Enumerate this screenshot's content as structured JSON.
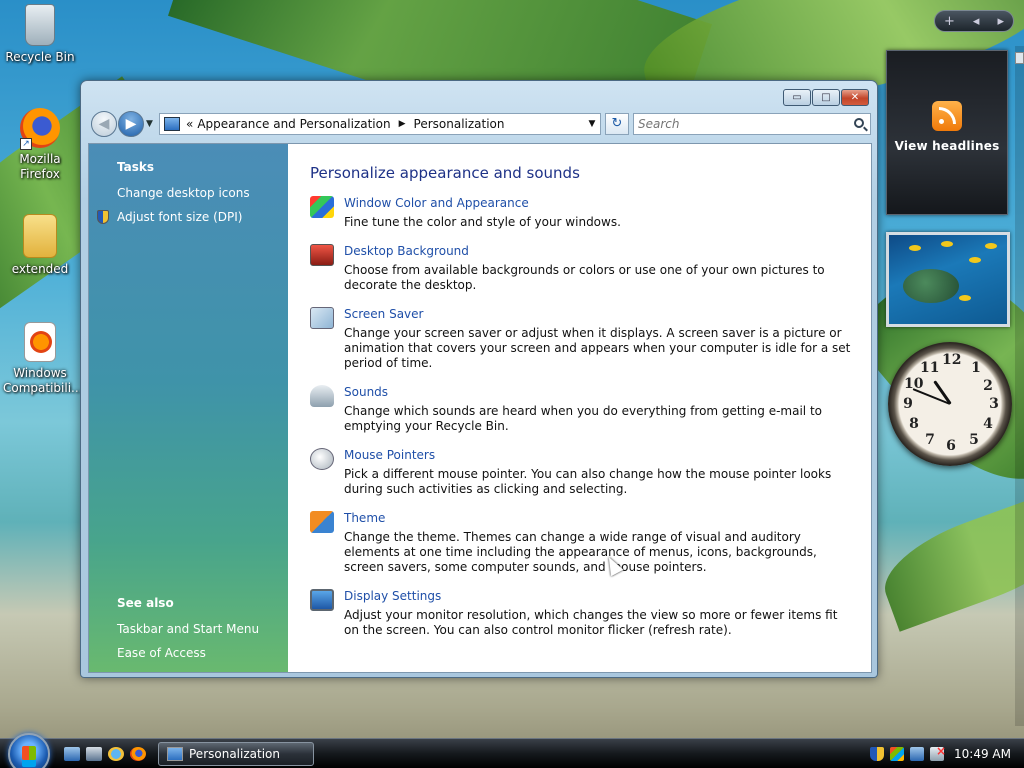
{
  "desktop": {
    "icons": [
      {
        "label": "Recycle Bin"
      },
      {
        "label": "Mozilla Firefox"
      },
      {
        "label": "extended"
      },
      {
        "label": "Windows Compatibili..."
      }
    ]
  },
  "sidebar": {
    "add_symbol": "+",
    "prev_symbol": "◂",
    "next_symbol": "▸",
    "feed_gadget_label": "View headlines"
  },
  "window": {
    "controls": {
      "minimize": "▭",
      "maximize": "□",
      "close": "✕"
    },
    "nav": {
      "back_symbol": "◀",
      "forward_symbol": "▶",
      "recent_symbol": "▼"
    },
    "address": {
      "overflow": "«",
      "crumbs": [
        "Appearance and Personalization",
        "Personalization"
      ],
      "separator": "▶",
      "dropdown": "▼"
    },
    "refresh_symbol": "↻",
    "search": {
      "placeholder": "Search"
    },
    "left_pane": {
      "tasks_heading": "Tasks",
      "tasks": [
        "Change desktop icons",
        "Adjust font size (DPI)"
      ],
      "see_also_heading": "See also",
      "see_also": [
        "Taskbar and Start Menu",
        "Ease of Access"
      ]
    },
    "main": {
      "title": "Personalize appearance and sounds",
      "items": [
        {
          "link": "Window Color and Appearance",
          "desc": "Fine tune the color and style of your windows.",
          "icon": "window-color-icon"
        },
        {
          "link": "Desktop Background",
          "desc": "Choose from available backgrounds or colors or use one of your own pictures to decorate the desktop.",
          "icon": "desktop-background-icon"
        },
        {
          "link": "Screen Saver",
          "desc": "Change your screen saver or adjust when it displays. A screen saver is a picture or animation that covers your screen and appears when your computer is idle for a set period of time.",
          "icon": "screen-saver-icon"
        },
        {
          "link": "Sounds",
          "desc": "Change which sounds are heard when you do everything from getting e-mail to emptying your Recycle Bin.",
          "icon": "sounds-icon"
        },
        {
          "link": "Mouse Pointers",
          "desc": "Pick a different mouse pointer. You can also change how the mouse pointer looks during such activities as clicking and selecting.",
          "icon": "mouse-pointers-icon"
        },
        {
          "link": "Theme",
          "desc": "Change the theme. Themes can change a wide range of visual and auditory elements at one time including the appearance of menus, icons, backgrounds, screen savers, some computer sounds, and mouse pointers.",
          "icon": "theme-icon"
        },
        {
          "link": "Display Settings",
          "desc": "Adjust your monitor resolution, which changes the view so more or fewer items fit on the screen. You can also control monitor flicker (refresh rate).",
          "icon": "display-settings-icon"
        }
      ]
    }
  },
  "taskbar": {
    "task_button": "Personalization",
    "clock": "10:49 AM"
  },
  "colors": {
    "link": "#1f4fa8",
    "title": "#1e3287",
    "pane_top": "#4b8db7",
    "pane_bottom": "#69b96f"
  }
}
